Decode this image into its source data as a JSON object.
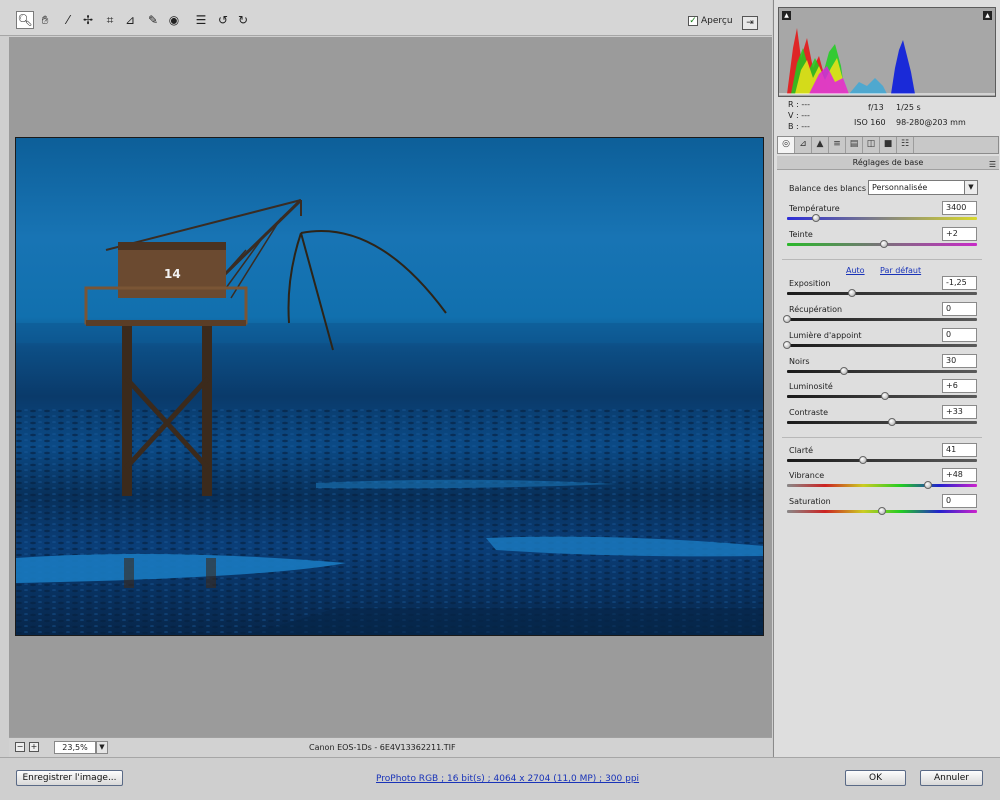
{
  "toolbar": {
    "tools": [
      {
        "name": "zoom-tool-icon",
        "glyph": "🔍︎",
        "active": true
      },
      {
        "name": "hand-tool-icon",
        "glyph": "✋︎"
      },
      {
        "name": "white-balance-tool-icon",
        "glyph": "⁄"
      },
      {
        "name": "color-sampler-tool-icon",
        "glyph": "✢"
      },
      {
        "name": "crop-tool-icon",
        "glyph": "⌗"
      },
      {
        "name": "straighten-tool-icon",
        "glyph": "⊿"
      },
      {
        "name": "spot-removal-tool-icon",
        "glyph": "✎"
      },
      {
        "name": "red-eye-tool-icon",
        "glyph": "◉"
      },
      {
        "name": "preferences-icon",
        "glyph": "☰"
      },
      {
        "name": "rotate-left-icon",
        "glyph": "↺"
      },
      {
        "name": "rotate-right-icon",
        "glyph": "↻"
      }
    ],
    "apercu_label": "Aperçu",
    "apercu_checked": "✓",
    "fullscreen_glyph": "⇥"
  },
  "zoom": {
    "minus": "−",
    "plus": "+",
    "value": "23,5%",
    "drop": "▼"
  },
  "camera_info": "Canon EOS-1Ds  -  6E4V13362211.TIF",
  "footer": {
    "save_label": "Enregistrer l'image...",
    "workflow_link": "ProPhoto RGB ; 16 bit(s) ; 4064 x 2704 (11,0 MP) ; 300 ppi",
    "ok_label": "OK",
    "cancel_label": "Annuler"
  },
  "readout": {
    "r": "R :  ---",
    "v": "V :  ---",
    "b": "B :  ---",
    "aperture": "f/13",
    "shutter": "1/25 s",
    "iso": "ISO 160",
    "lens": "98-280@203 mm"
  },
  "tabs": [
    "◎",
    "⊿",
    "▲",
    "≡",
    "▤",
    "◫",
    "■",
    "☷"
  ],
  "panel": {
    "title": "Réglages de base",
    "menu_icon": "☰",
    "wb_label": "Balance des blancs :",
    "wb_value": "Personnalisée",
    "wb_drop": "▼",
    "auto_label": "Auto",
    "default_label": "Par défaut"
  },
  "sliders": [
    {
      "id": "temperature",
      "label": "Température",
      "value": "3400",
      "level": 0.15
    },
    {
      "id": "teinte",
      "label": "Teinte",
      "value": "+2",
      "level": 0.51
    },
    {
      "id": "exposition",
      "label": "Exposition",
      "value": "-1,25",
      "level": 0.34
    },
    {
      "id": "recuperation",
      "label": "Récupération",
      "value": "0",
      "level": 0.0
    },
    {
      "id": "lumiere",
      "label": "Lumière d'appoint",
      "value": "0",
      "level": 0.0
    },
    {
      "id": "noirs",
      "label": "Noirs",
      "value": "30",
      "level": 0.3
    },
    {
      "id": "luminosite",
      "label": "Luminosité",
      "value": "+6",
      "level": 0.515
    },
    {
      "id": "contraste",
      "label": "Contraste",
      "value": "+33",
      "level": 0.55
    },
    {
      "id": "clarte",
      "label": "Clarté",
      "value": "41",
      "level": 0.4
    },
    {
      "id": "vibrance",
      "label": "Vibrance",
      "value": "+48",
      "level": 0.74
    },
    {
      "id": "saturation",
      "label": "Saturation",
      "value": "0",
      "level": 0.5
    }
  ],
  "colors": {
    "accent_link": "#1933b8",
    "photo_sky": "#1874b4",
    "photo_sea": "#0a3a6a"
  }
}
